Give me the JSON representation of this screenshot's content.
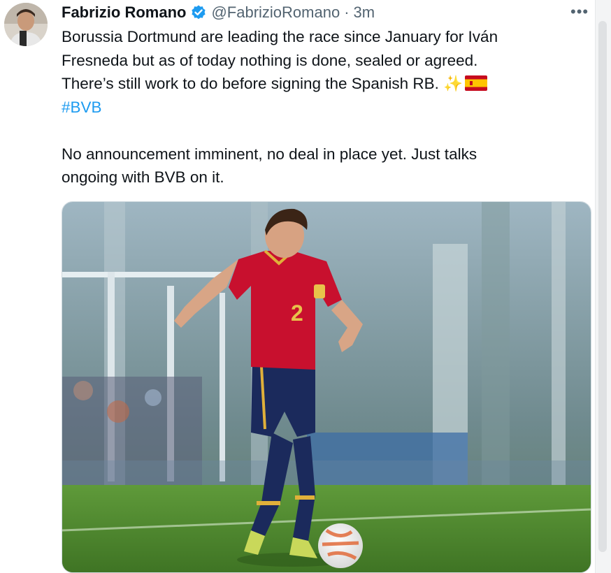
{
  "tweet": {
    "author_name": "Fabrizio Romano",
    "handle": "@FabrizioRomano",
    "separator": "·",
    "time": "3m",
    "more_label": "•••",
    "lines": [
      "Borussia Dortmund are leading the race since January for Iván",
      "Fresneda but as of today nothing is done, sealed or agreed.",
      "There’s still work to do before signing the Spanish RB."
    ],
    "sparkle_emoji": "✨",
    "flag_icon": "spain-flag-icon",
    "hashtag": "#BVB",
    "lines2": [
      "No announcement imminent, no deal in place yet. Just talks",
      "ongoing with BVB on it."
    ],
    "jersey_number": "2"
  },
  "colors": {
    "link": "#1d9bf0",
    "verified": "#1d9bf0",
    "secondary_text": "#536471",
    "shirt": "#c8102e",
    "shorts": "#1b2a5c",
    "pitch": "#4f8a2e"
  }
}
